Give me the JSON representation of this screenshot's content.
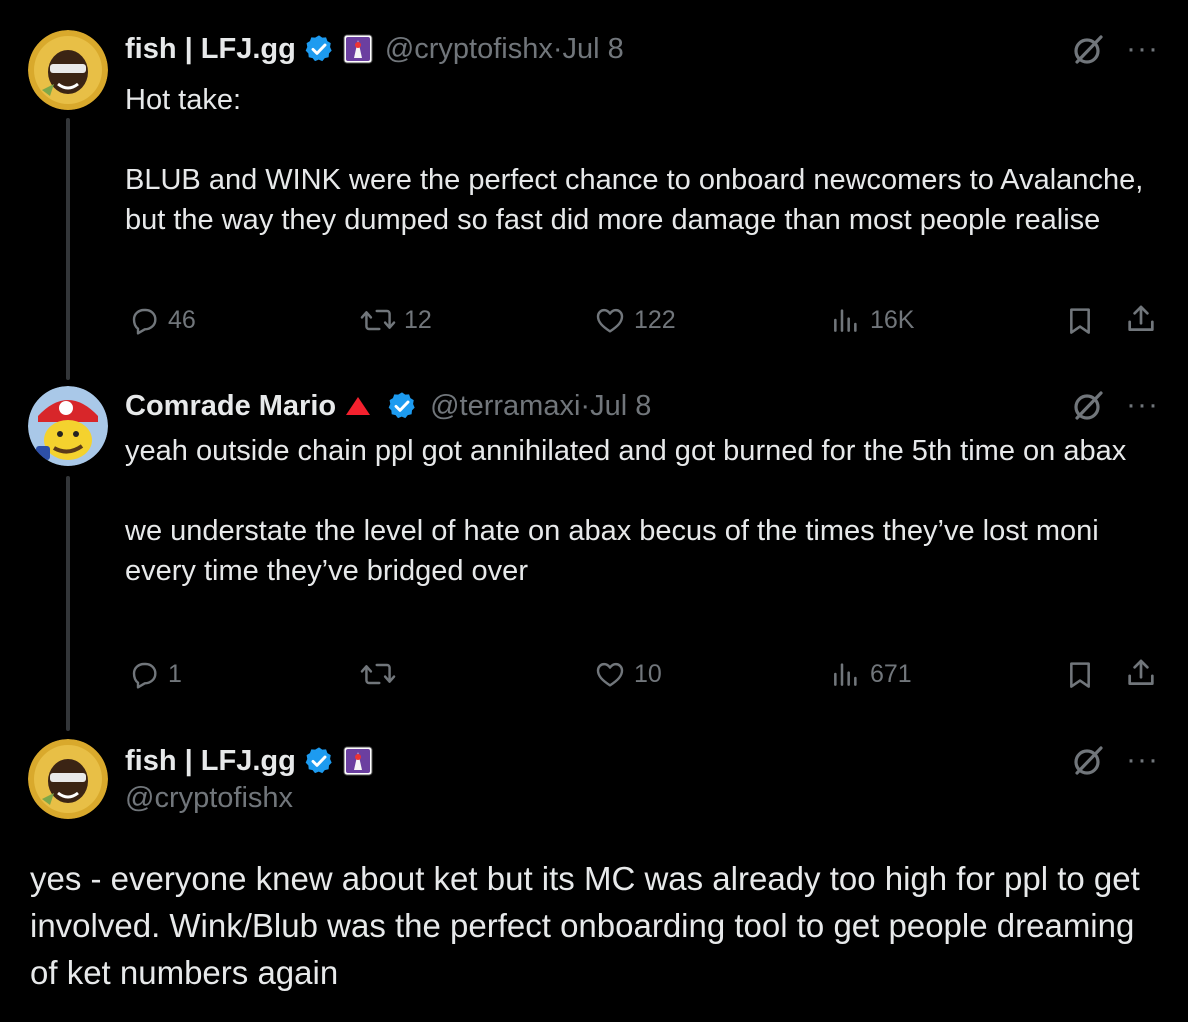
{
  "tweets": [
    {
      "author_name": "fish | LFJ.gg",
      "handle": "@cryptofishx",
      "date_sep": " · ",
      "date": "Jul 8",
      "text": "Hot take:\n\nBLUB and WINK were the perfect chance to onboard newcomers to Avalanche, but the way they dumped so fast did more damage than most people realise",
      "replies": "46",
      "reposts": "12",
      "likes": "122",
      "views": "16K"
    },
    {
      "author_name": "Comrade Mario",
      "handle": "@terramaxi",
      "date_sep": " · ",
      "date": "Jul 8",
      "text": "yeah outside chain ppl got annihilated and got burned for the 5th time on abax\n\nwe understate the level of hate on abax becus of the times they’ve lost moni every time they’ve bridged over",
      "replies": "1",
      "reposts": "",
      "likes": "10",
      "views": "671"
    },
    {
      "author_name": "fish | LFJ.gg",
      "handle": "@cryptofishx",
      "text": "yes - everyone knew about ket but its MC was already too high for ppl to get involved. Wink/Blub was the perfect onboarding tool to get people dreaming of ket numbers again"
    }
  ],
  "more_label": "···",
  "colors": {
    "background": "#000000",
    "text": "#e7e9ea",
    "muted": "#71767b",
    "verified": "#1d9bf0",
    "thread_line": "#333639",
    "triangle": "#f4212e"
  },
  "icons": [
    "reply-icon",
    "repost-icon",
    "like-icon",
    "views-icon",
    "bookmark-icon",
    "share-icon",
    "grok-icon",
    "more-icon",
    "verified-icon",
    "affiliate-badge-icon",
    "triangle-icon"
  ]
}
